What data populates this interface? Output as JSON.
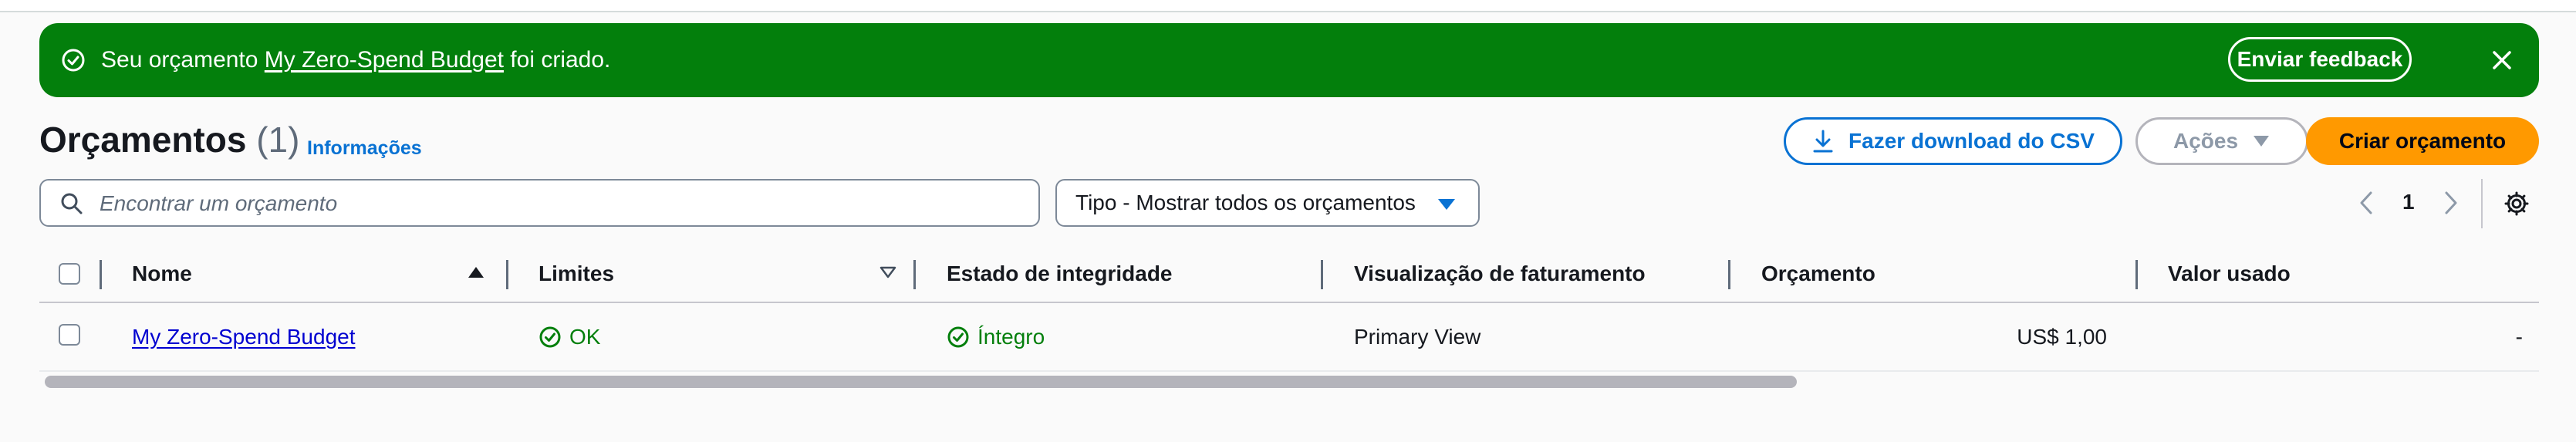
{
  "flash": {
    "message_before": "Seu orçamento ",
    "budget_link": "My Zero-Spend Budget",
    "message_after": " foi criado.",
    "feedback_label": "Enviar feedback",
    "success_icon": "check-circle-icon",
    "close_icon": "close-icon",
    "color": "#037f0c"
  },
  "header": {
    "title": "Orçamentos",
    "count": "(1)",
    "info_link": "Informações"
  },
  "toolbar": {
    "download_csv_label": "Fazer download do CSV",
    "actions_label": "Ações",
    "create_label": "Criar orçamento",
    "download_icon": "download-icon",
    "primary_color": "#ff9900",
    "link_color": "#0972d3"
  },
  "filters": {
    "search_placeholder": "Encontrar um orçamento",
    "search_value": "",
    "type_select_value": "Tipo - Mostrar todos os orçamentos"
  },
  "pagination": {
    "current_page": "1"
  },
  "table": {
    "columns": [
      "Nome",
      "Limites",
      "Estado de integridade",
      "Visualização de faturamento",
      "Orçamento",
      "Valor usado"
    ],
    "sort": {
      "column": "Nome",
      "direction": "ascending"
    },
    "rows": [
      {
        "name": "My Zero-Spend Budget",
        "limits": "OK",
        "health": "Íntegro",
        "billing_view": "Primary View",
        "budget": "US$ 1,00",
        "used": "-"
      }
    ]
  }
}
